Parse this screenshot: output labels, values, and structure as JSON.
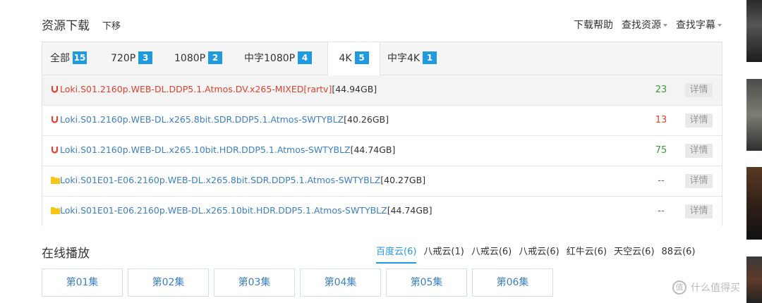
{
  "header": {
    "title": "资源下载",
    "sub": "下移",
    "links": [
      "下载帮助",
      "查找资源",
      "查找字幕"
    ]
  },
  "tabs": [
    {
      "label": "全部",
      "count": "15"
    },
    {
      "label": "720P",
      "count": "3"
    },
    {
      "label": "1080P",
      "count": "2"
    },
    {
      "label": "中字1080P",
      "count": "4"
    },
    {
      "label": "4K",
      "count": "5"
    },
    {
      "label": "中字4K",
      "count": "1"
    }
  ],
  "rows": [
    {
      "name": "Loki.S01.2160p.WEB-DL.DDP5.1.Atmos.DV.x265-MIXED[rartv]",
      "size": "[44.94GB]",
      "num": "23",
      "detail": "详情"
    },
    {
      "name": "Loki.S01.2160p.WEB-DL.x265.8bit.SDR.DDP5.1.Atmos-SWTYBLZ",
      "size": "[40.26GB]",
      "num": "13",
      "detail": "详情"
    },
    {
      "name": "Loki.S01.2160p.WEB-DL.x265.10bit.HDR.DDP5.1.Atmos-SWTYBLZ",
      "size": "[44.74GB]",
      "num": "75",
      "detail": "详情"
    },
    {
      "name": "Loki.S01E01-E06.2160p.WEB-DL.x265.8bit.SDR.DDP5.1.Atmos-SWTYBLZ",
      "size": "[40.27GB]",
      "num": "--",
      "detail": "详情"
    },
    {
      "name": "Loki.S01E01-E06.2160p.WEB-DL.x265.10bit.HDR.DDP5.1.Atmos-SWTYBLZ",
      "size": "[44.74GB]",
      "num": "--",
      "detail": "详情"
    }
  ],
  "online": {
    "title": "在线播放",
    "providers": [
      "百度云(6)",
      "八戒云(1)",
      "八戒云(6)",
      "八戒云(6)",
      "红牛云(6)",
      "天空云(6)",
      "88云(6)"
    ]
  },
  "episodes": [
    "第01集",
    "第02集",
    "第03集",
    "第04集",
    "第05集",
    "第06集"
  ],
  "watermark": "什么值得买",
  "colors": {
    "accent": "#1e9be0",
    "link": "#3b7fc4",
    "highlight_red": "#e0402e",
    "seed_green": "#3a9a3a"
  }
}
